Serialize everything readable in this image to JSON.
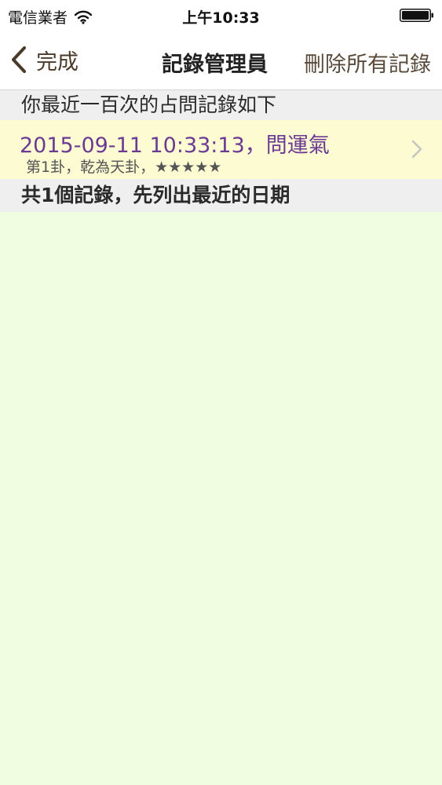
{
  "status_bar": {
    "carrier": "電信業者",
    "time": "上午10:33"
  },
  "nav": {
    "back_label": "完成",
    "title": "記錄管理員",
    "delete_all_label": "刪除所有記錄"
  },
  "list": {
    "header": "你最近一百次的占問記錄如下",
    "records": [
      {
        "title": "2015-09-11 10:33:13，問運氣",
        "subtitle": "第1卦，乾為天卦，★★★★★"
      }
    ],
    "footer": "共1個記錄，先列出最近的日期"
  },
  "colors": {
    "background": "#f0fde0",
    "record_background": "#fdfbd2",
    "record_title": "#6b3a93",
    "header_background": "#efefef"
  },
  "icons": {
    "wifi": "wifi-icon",
    "battery": "battery-icon",
    "back": "chevron-left-icon",
    "disclosure": "chevron-right-icon"
  }
}
